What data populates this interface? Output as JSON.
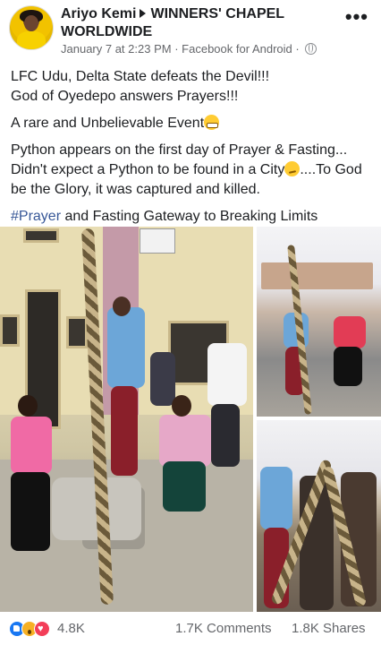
{
  "post": {
    "author": "Ariyo Kemi",
    "group": "WINNERS' CHAPEL WORLDWIDE",
    "timestamp": "January 7 at 2:23 PM",
    "source": "Facebook for Android",
    "separator": "·",
    "icons": {
      "avatar": "profile-photo",
      "privacy": "globe-icon",
      "more": "more-options-icon",
      "arrow": "right-arrow-icon"
    }
  },
  "body": {
    "line1": "LFC Udu, Delta State defeats the Devil!!!",
    "line2": "God of Oyedepo answers Prayers!!!",
    "para2": "A rare and Unbelievable Event",
    "para3a": "Python appears on the first day of Prayer & Fasting... Didn't expect a Python to be found in a City",
    "para3b": "....To God be the Glory, it was captured and killed.",
    "hashtag": "#Prayer",
    "hashtag_rest": " and Fasting Gateway to Breaking Limits"
  },
  "photos": {
    "count": 3
  },
  "stats": {
    "reactions": "4.8K",
    "comments": "1.7K Comments",
    "shares": "1.8K Shares",
    "reaction_types": [
      "like",
      "wow",
      "love"
    ]
  },
  "colors": {
    "hashtag": "#385898",
    "meta": "#65676b",
    "like": "#1877f2",
    "love": "#f33e58",
    "wow": "#f7b125"
  }
}
